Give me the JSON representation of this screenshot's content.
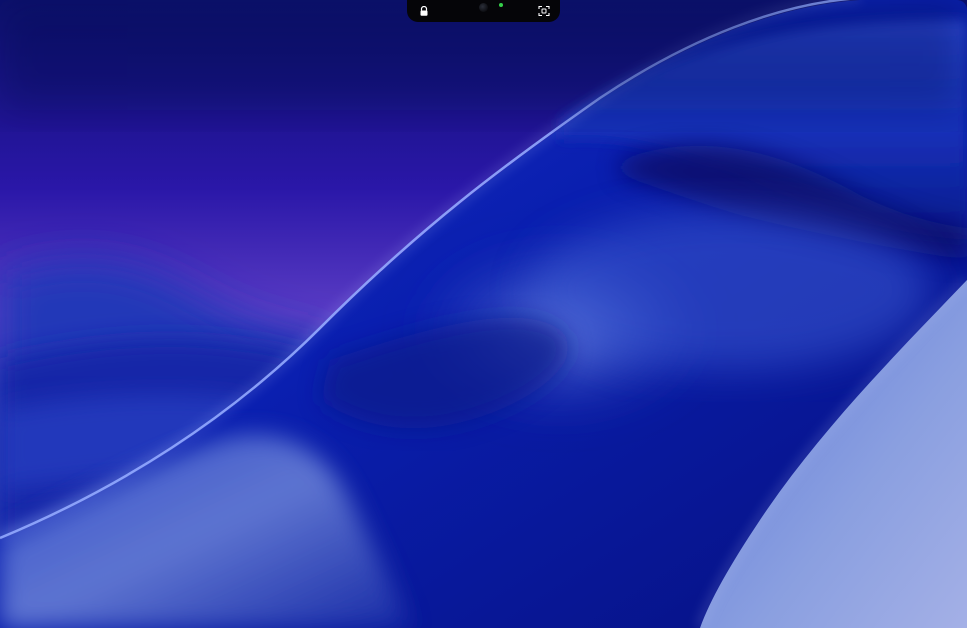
{
  "screen": {
    "description_colors": {
      "sky_top": "#0d0f6e",
      "sky_mid": "#3a22b8",
      "sky_glow": "#6a55cf",
      "wave_dark": "#0a1aa0",
      "wave_light": "#4a6ae0",
      "highlight": "#8fa6ff"
    }
  },
  "menu_bar_island": {
    "icons": [
      "lock-icon",
      "camera-icon",
      "camera-indicator-led",
      "screen-capture-icon"
    ],
    "led_color": "#35d04a",
    "icon_color": "#ffffff"
  }
}
